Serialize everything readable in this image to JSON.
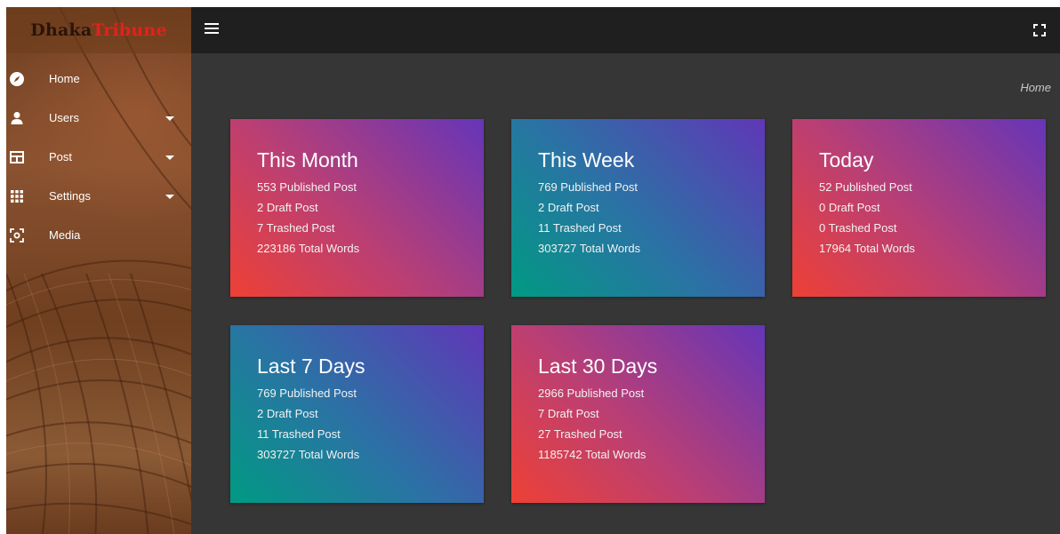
{
  "brand": {
    "part1": "Dhaka",
    "part2": "Tribune"
  },
  "sidebar": {
    "items": [
      {
        "label": "Home",
        "icon": "compass-icon",
        "has_submenu": false
      },
      {
        "label": "Users",
        "icon": "user-icon",
        "has_submenu": true
      },
      {
        "label": "Post",
        "icon": "post-icon",
        "has_submenu": true
      },
      {
        "label": "Settings",
        "icon": "grid-icon",
        "has_submenu": true
      },
      {
        "label": "Media",
        "icon": "media-icon",
        "has_submenu": false
      }
    ]
  },
  "header": {
    "menu_icon": "hamburger-icon",
    "fullscreen_icon": "fullscreen-icon"
  },
  "breadcrumb": "Home",
  "colors": {
    "sidebar_bg": "#7a4a2a",
    "logo_accent": "#e4211c",
    "content_bg": "#363636",
    "topbar_bg": "#1f1f1f",
    "gradient_red": [
      "#ee4035",
      "#6535b8"
    ],
    "gradient_teal": [
      "#009a83",
      "#6037b7"
    ]
  },
  "cards": [
    {
      "title": "This Month",
      "published": "553 Published Post",
      "draft": "2 Draft Post",
      "trashed": "7 Trashed Post",
      "words": "223186 Total Words"
    },
    {
      "title": "This Week",
      "published": "769 Published Post",
      "draft": "2 Draft Post",
      "trashed": "11 Trashed Post",
      "words": "303727 Total Words"
    },
    {
      "title": "Today",
      "published": "52 Published Post",
      "draft": "0 Draft Post",
      "trashed": "0 Trashed Post",
      "words": "17964 Total Words"
    },
    {
      "title": "Last 7 Days",
      "published": "769 Published Post",
      "draft": "2 Draft Post",
      "trashed": "11 Trashed Post",
      "words": "303727 Total Words"
    },
    {
      "title": "Last 30 Days",
      "published": "2966 Published Post",
      "draft": "7 Draft Post",
      "trashed": "27 Trashed Post",
      "words": "1185742 Total Words"
    }
  ]
}
